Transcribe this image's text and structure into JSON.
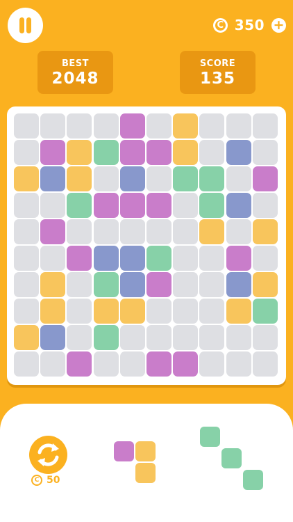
{
  "header": {
    "coins": "350",
    "coin_symbol": "C",
    "add_symbol": "+"
  },
  "stats": {
    "best_label": "BEST",
    "best_value": "2048",
    "score_label": "SCORE",
    "score_value": "135"
  },
  "colors": {
    "background": "#FBB120",
    "empty": "#DEDFE3",
    "purple": "#C97DCA",
    "yellow": "#F8C55C",
    "green": "#87D1A8",
    "blue": "#8898CC"
  },
  "board": {
    "rows": [
      [
        "e",
        "e",
        "e",
        "e",
        "p",
        "e",
        "y",
        "e",
        "e",
        "e"
      ],
      [
        "e",
        "p",
        "y",
        "g",
        "p",
        "p",
        "y",
        "e",
        "b",
        "e"
      ],
      [
        "y",
        "b",
        "y",
        "e",
        "b",
        "e",
        "g",
        "g",
        "e",
        "p"
      ],
      [
        "e",
        "e",
        "g",
        "p",
        "p",
        "p",
        "e",
        "g",
        "b",
        "e"
      ],
      [
        "e",
        "p",
        "e",
        "e",
        "e",
        "e",
        "e",
        "y",
        "e",
        "y"
      ],
      [
        "e",
        "e",
        "p",
        "b",
        "b",
        "g",
        "e",
        "e",
        "p",
        "e"
      ],
      [
        "e",
        "y",
        "e",
        "g",
        "b",
        "p",
        "e",
        "e",
        "b",
        "y"
      ],
      [
        "e",
        "y",
        "e",
        "y",
        "y",
        "e",
        "e",
        "e",
        "y",
        "g"
      ],
      [
        "y",
        "b",
        "e",
        "g",
        "e",
        "e",
        "e",
        "e",
        "e",
        "e"
      ],
      [
        "e",
        "e",
        "p",
        "e",
        "e",
        "p",
        "p",
        "e",
        "e",
        "e"
      ]
    ]
  },
  "tray": {
    "refresh_cost": "50",
    "pieces": [
      {
        "name": "piece-l-shape",
        "color": "mixed",
        "cells": [
          {
            "r": 0,
            "c": 0,
            "k": "p"
          },
          {
            "r": 0,
            "c": 1,
            "k": "y"
          },
          {
            "r": 1,
            "c": 1,
            "k": "y"
          }
        ]
      },
      {
        "name": "piece-diagonal",
        "color": "green",
        "cells": [
          {
            "r": 0,
            "c": 0,
            "k": "g"
          },
          {
            "r": 1,
            "c": 1,
            "k": "g"
          },
          {
            "r": 2,
            "c": 2,
            "k": "g"
          }
        ]
      }
    ]
  }
}
